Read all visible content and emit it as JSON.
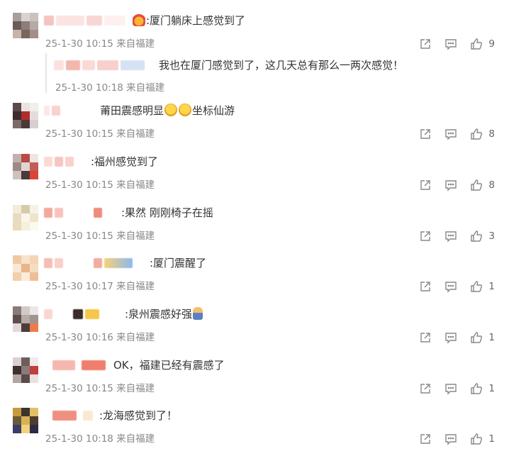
{
  "comments": [
    {
      "text_before": ":厦门躺床上感觉到了",
      "meta": "25-1-30 10:15 来自福建",
      "likes": "9",
      "emoji_lead": "crown-emoji",
      "reply": {
        "text": "我也在厦门感觉到了，这几天总有那么一两次感觉！",
        "meta": "25-1-30 10:18 来自福建"
      }
    },
    {
      "text_before": "莆田震感明显",
      "text_after": "坐标仙游",
      "meta": "25-1-30 10:15 来自福建",
      "likes": "8"
    },
    {
      "text_before": ":福州感觉到了",
      "meta": "25-1-30 10:15 来自福建",
      "likes": "8"
    },
    {
      "text_before": ":果然 刚刚椅子在摇",
      "meta": "25-1-30 10:15 来自福建",
      "likes": "3"
    },
    {
      "text_before": ":厦门震醒了",
      "meta": "25-1-30 10:17 来自福建",
      "likes": "1"
    },
    {
      "text_before": ":泉州震感好强",
      "meta": "25-1-30 10:16 来自福建",
      "likes": "1"
    },
    {
      "text_before": "OK，福建已经有震感了",
      "meta": "25-1-30 10:15 来自福建",
      "likes": "1"
    },
    {
      "text_before": ":龙海感觉到了！",
      "meta": "25-1-30 10:18 来自福建",
      "likes": "1"
    }
  ],
  "icons": {
    "share": "share-icon",
    "comment": "comment-icon",
    "like": "thumbs-up-icon"
  },
  "colors": {
    "text": "#333333",
    "meta": "#888888",
    "icon": "#888888"
  }
}
